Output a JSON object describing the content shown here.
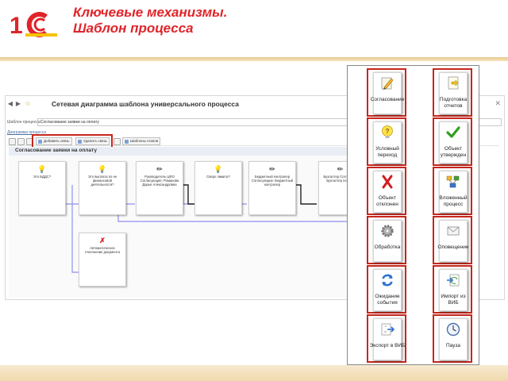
{
  "slide": {
    "title_line1": "Ключевые механизмы.",
    "title_line2": "Шаблон процесса",
    "logo_text": "1С"
  },
  "window": {
    "title": "Сетевая диаграмма шаблона универсального процесса",
    "field_label": "Шаблон процесса:",
    "field_value": "Согласование заявки на оплату",
    "tab": "Диаграмма процесса",
    "toolbar": {
      "add_link": "Добавить связь",
      "remove_link": "Удалить связь",
      "templates": "Шаблоны этапов"
    },
    "diagram_title": "Согласование заявки на оплату"
  },
  "nodes": [
    {
      "icon": "question-icon",
      "text": "Это БДДС?"
    },
    {
      "icon": "question-icon",
      "text": "Это выплата по не финансовой деятельности?"
    },
    {
      "icon": "pencil-icon",
      "text": "Руководитель ЦФО Согласующие: Романова Дарья Александровна"
    },
    {
      "icon": "question-icon",
      "text": "Сверх лимита?"
    },
    {
      "icon": "pencil-icon",
      "text": "Бюджетный контролер Согласующие: Бюджетный контролер"
    },
    {
      "icon": "pencil-icon",
      "text": "Бухгалтер Согласующие: Бухгалтер по зарпл..."
    },
    {
      "icon": "cross-icon",
      "text": "Автоматическое отклонение документа"
    }
  ],
  "palette": [
    {
      "label": "Согласование",
      "icon": "pencil-icon"
    },
    {
      "label": "Подготовка отчетов",
      "icon": "report-icon"
    },
    {
      "label": "Условный переход",
      "icon": "question-icon"
    },
    {
      "label": "Объект утвержден",
      "icon": "checkmark-icon"
    },
    {
      "label": "Объект отклонен",
      "icon": "cross-icon"
    },
    {
      "label": "Вложенный процесс",
      "icon": "nested-process-icon"
    },
    {
      "label": "Обработка",
      "icon": "gear-icon"
    },
    {
      "label": "Оповещение",
      "icon": "envelope-icon"
    },
    {
      "label": "Ожидание события",
      "icon": "refresh-icon"
    },
    {
      "label": "Импорт из ВИБ",
      "icon": "import-icon"
    },
    {
      "label": "Экспорт в ВИБ",
      "icon": "export-icon"
    },
    {
      "label": "Пауза",
      "icon": "clock-icon"
    }
  ],
  "colors": {
    "accent_red": "#e0242a",
    "frame_red": "#c7261c",
    "connector_blue": "#8f8ff0",
    "brand_yellow": "#f6c200"
  }
}
